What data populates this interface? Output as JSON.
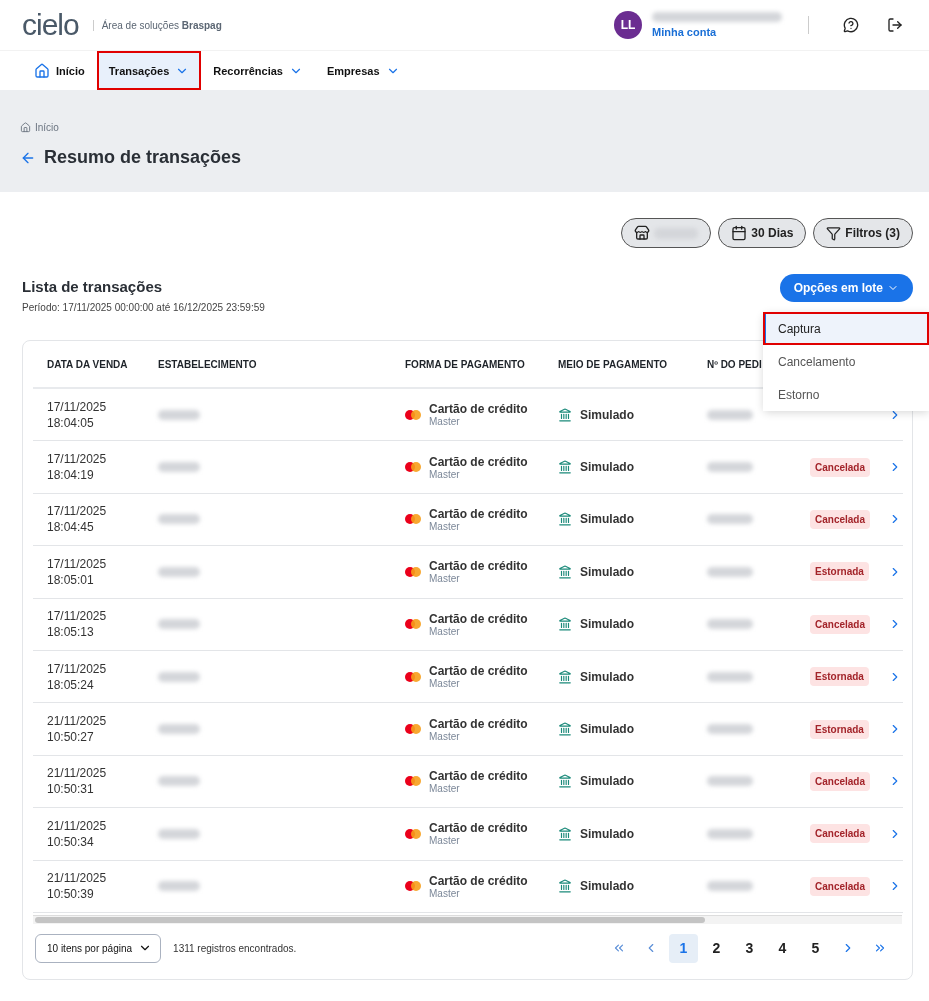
{
  "header": {
    "logo": "cielo",
    "subtitle": "Área de soluções **Braspag**",
    "avatar": "LL",
    "account_link": "Minha conta"
  },
  "nav": [
    {
      "label": "Início",
      "kind": "home",
      "selected": false,
      "highlighted": false
    },
    {
      "label": "Transações",
      "kind": "dropdown",
      "selected": true,
      "highlighted": true
    },
    {
      "label": "Recorrências",
      "kind": "dropdown",
      "selected": false,
      "highlighted": false
    },
    {
      "label": "Empresas",
      "kind": "dropdown",
      "selected": false,
      "highlighted": false
    }
  ],
  "breadcrumb": "Início",
  "page_title": "Resumo de transações",
  "filters": [
    {
      "kind": "store"
    },
    {
      "kind": "date",
      "label": "30 Dias"
    },
    {
      "kind": "filter",
      "label": "Filtros (3)"
    }
  ],
  "list": {
    "title": "Lista de transações",
    "period": "Período: 17/11/2025 00:00:00 até 16/12/2025 23:59:59",
    "batch_button": "Opções em lote"
  },
  "batch_menu": [
    {
      "label": "Captura",
      "selected": true,
      "highlighted": true
    },
    {
      "label": "Cancelamento",
      "selected": false,
      "highlighted": false
    },
    {
      "label": "Estorno",
      "selected": false,
      "highlighted": false
    }
  ],
  "table": {
    "columns": [
      "DATA DA VENDA",
      "ESTABELECIMENTO",
      "FORMA DE PAGAMENTO",
      "MEIO DE PAGAMENTO",
      "Nº DO PEDI"
    ],
    "rows": [
      {
        "date": "17/11/2025",
        "time": "18:04:05",
        "payment": "Cartão de crédito",
        "brand": "Master",
        "method": "Simulado"
      },
      {
        "date": "17/11/2025",
        "time": "18:04:19",
        "payment": "Cartão de crédito",
        "brand": "Master",
        "method": "Simulado",
        "status": "Cancelada"
      },
      {
        "date": "17/11/2025",
        "time": "18:04:45",
        "payment": "Cartão de crédito",
        "brand": "Master",
        "method": "Simulado",
        "status": "Cancelada"
      },
      {
        "date": "17/11/2025",
        "time": "18:05:01",
        "payment": "Cartão de crédito",
        "brand": "Master",
        "method": "Simulado",
        "status": "Estornada"
      },
      {
        "date": "17/11/2025",
        "time": "18:05:13",
        "payment": "Cartão de crédito",
        "brand": "Master",
        "method": "Simulado",
        "status": "Cancelada"
      },
      {
        "date": "17/11/2025",
        "time": "18:05:24",
        "payment": "Cartão de crédito",
        "brand": "Master",
        "method": "Simulado",
        "status": "Estornada"
      },
      {
        "date": "21/11/2025",
        "time": "10:50:27",
        "payment": "Cartão de crédito",
        "brand": "Master",
        "method": "Simulado",
        "status": "Estornada"
      },
      {
        "date": "21/11/2025",
        "time": "10:50:31",
        "payment": "Cartão de crédito",
        "brand": "Master",
        "method": "Simulado",
        "status": "Cancelada"
      },
      {
        "date": "21/11/2025",
        "time": "10:50:34",
        "payment": "Cartão de crédito",
        "brand": "Master",
        "method": "Simulado",
        "status": "Cancelada"
      },
      {
        "date": "21/11/2025",
        "time": "10:50:39",
        "payment": "Cartão de crédito",
        "brand": "Master",
        "method": "Simulado",
        "status": "Cancelada"
      }
    ]
  },
  "footer": {
    "page_size": "10 itens por página",
    "records": "1311 registros encontrados.",
    "pages": [
      {
        "label": "1",
        "selected": true
      },
      {
        "label": "2",
        "selected": false
      },
      {
        "label": "3",
        "selected": false
      },
      {
        "label": "4",
        "selected": false
      },
      {
        "label": "5",
        "selected": false
      }
    ]
  }
}
